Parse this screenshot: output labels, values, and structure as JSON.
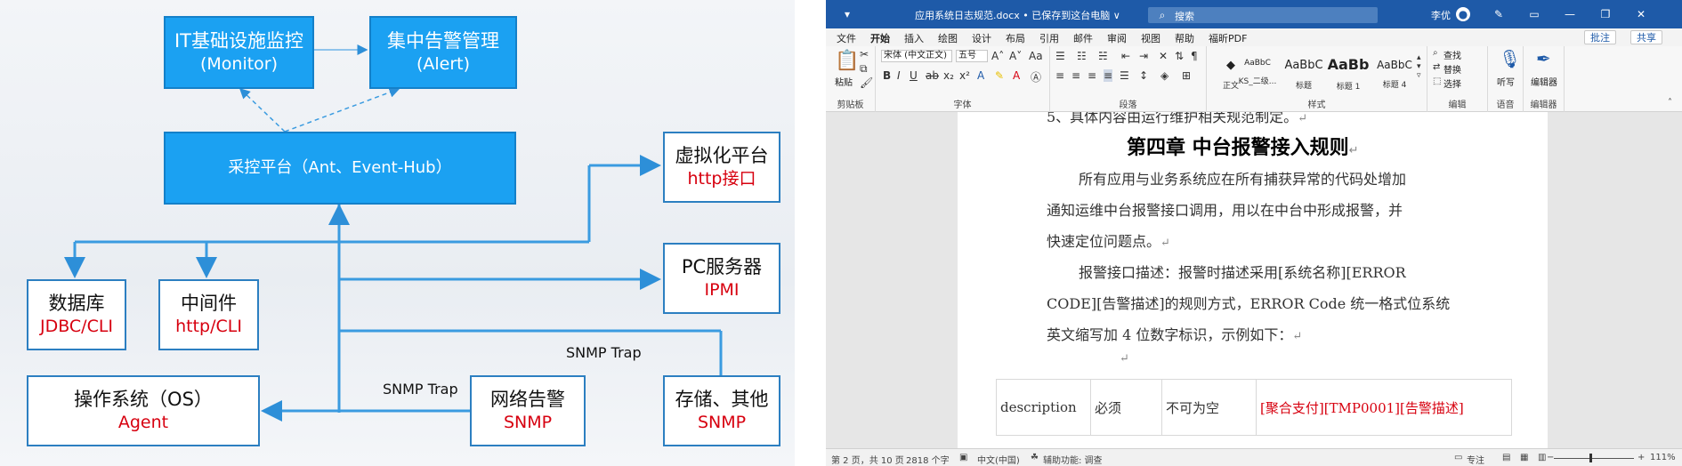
{
  "diagram": {
    "boxes": {
      "monitor": {
        "line1": "IT基础设施监控",
        "line2": "(Monitor)"
      },
      "alert": {
        "line1": "集中告警管理",
        "line2": "(Alert)"
      },
      "platform": {
        "line1": "采控平台（Ant、Event-Hub）"
      },
      "virtual": {
        "line1": "虚拟化平台",
        "line2": "http接口"
      },
      "pc": {
        "line1": "PC服务器",
        "line2": "IPMI"
      },
      "db": {
        "line1": "数据库",
        "line2": "JDBC/CLI"
      },
      "middleware": {
        "line1": "中间件",
        "line2": "http/CLI"
      },
      "os": {
        "line1": "操作系统（OS）",
        "line2": "Agent"
      },
      "network": {
        "line1": "网络告警",
        "line2": "SNMP"
      },
      "storage": {
        "line1": "存储、其他",
        "line2": "SNMP"
      }
    },
    "labels": {
      "snmp_trap_1": "SNMP Trap",
      "snmp_trap_2": "SNMP Trap"
    }
  },
  "word": {
    "titlebar": {
      "title": "应用系统日志规范.docx • 已保存到这台电脑 ∨",
      "search_placeholder": "搜索",
      "user": "李优"
    },
    "tabs": [
      "文件",
      "开始",
      "插入",
      "绘图",
      "设计",
      "布局",
      "引用",
      "邮件",
      "审阅",
      "视图",
      "帮助",
      "福昕PDF"
    ],
    "active_tab": "开始",
    "comments_button": "批注",
    "share_button": "共享",
    "ribbon": {
      "paste": "粘贴",
      "clipboard": "剪贴板",
      "font_name": "宋体 (中文正文)",
      "font_size": "五号",
      "font_group": "字体",
      "paragraph_group": "段落",
      "styles": [
        {
          "preview": "◆",
          "name": "正文"
        },
        {
          "preview": "AaBbC",
          "name": "KS_二级..."
        },
        {
          "preview": "AaBbC",
          "name": "标题"
        },
        {
          "preview": "AaBb",
          "name": "标题 1"
        },
        {
          "preview": "AaBbC",
          "name": "标题 4"
        }
      ],
      "styles_group": "样式",
      "find": "查找",
      "replace": "替换",
      "select": "选择",
      "editing_group": "编辑",
      "dictate": "听写",
      "voice_group": "语音",
      "editor": "编辑器",
      "editor_group": "编辑器"
    },
    "document": {
      "prev_line": "5、具体内容由运行维护相关规范制定。",
      "heading": "第四章 中台报警接入规则",
      "para1": [
        "所有应用与业务系统应在所有捕获异常的代码处增加",
        "通知运维中台报警接口调用，用以在中台中形成报警，并",
        "快速定位问题点。"
      ],
      "para2": [
        "报警接口描述：报警时描述采用[系统名称][ERROR",
        "CODE][告警描述]的规则方式，ERROR Code 统一格式位系统",
        "英文缩写加 4 位数字标识，示例如下："
      ],
      "table_row": [
        "description",
        "必须",
        "不可为空",
        "[聚合支付][TMP0001][告警描述]"
      ]
    },
    "statusbar": {
      "page": "第 2 页，共 10 页",
      "words": "2818 个字",
      "language": "中文(中国)",
      "accessibility": "辅助功能: 调查",
      "focus": "专注",
      "zoom": "111%"
    }
  }
}
